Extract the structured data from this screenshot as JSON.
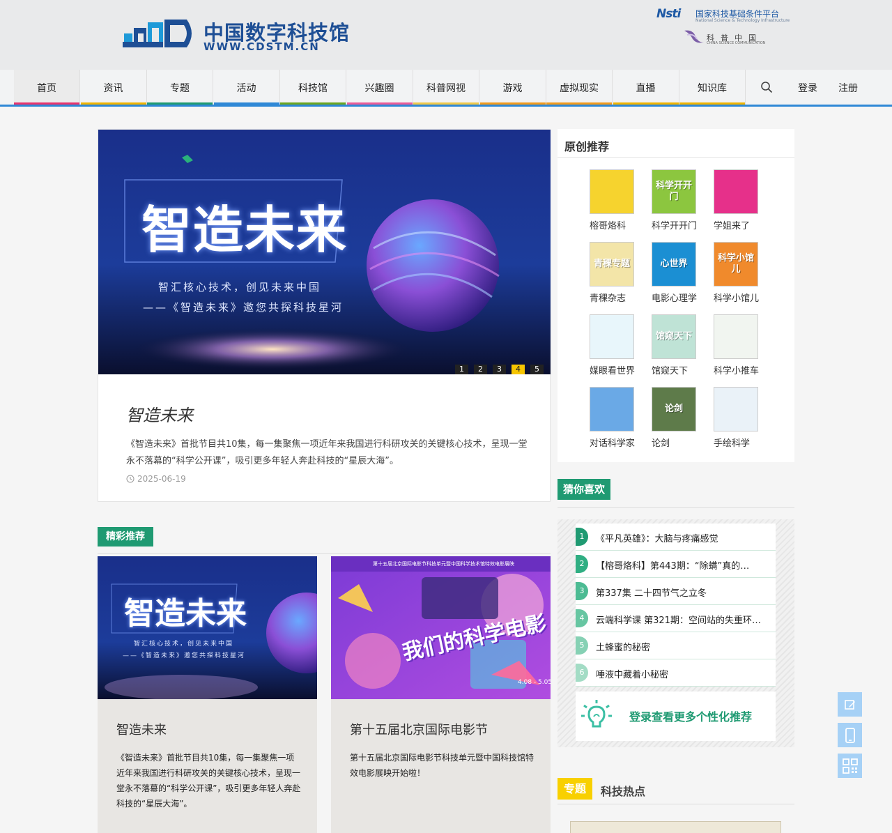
{
  "header": {
    "logo_cn": "中国数字科技馆",
    "logo_en": "WWW.CDSTM.CN",
    "partner1_mark": "Nsti",
    "partner1_cn": "国家科技基础条件平台",
    "partner1_en": "National Science & Technology Infrastructure",
    "partner2_cn": "科普中国",
    "partner2_en": "CHINA SCIENCE COMMUNICATION"
  },
  "nav": {
    "items": [
      {
        "label": "首页",
        "color": "#e8336d"
      },
      {
        "label": "资讯",
        "color": "#f0b400"
      },
      {
        "label": "专题",
        "color": "#1f9a72"
      },
      {
        "label": "活动",
        "color": "#2f88d6"
      },
      {
        "label": "科技馆",
        "color": "#6aa520"
      },
      {
        "label": "兴趣圈",
        "color": "#ea5c98"
      },
      {
        "label": "科普网视",
        "color": "#f0c94a"
      },
      {
        "label": "游戏",
        "color": "#f29b1d"
      },
      {
        "label": "虚拟现实",
        "color": "#f29b1d"
      },
      {
        "label": "直播",
        "color": "#f0b400"
      },
      {
        "label": "知识库",
        "color": "#f0b400"
      }
    ],
    "login": "登录",
    "register": "注册"
  },
  "hero": {
    "banner_title": "智造未来",
    "banner_slogan1": "智汇核心技术，创见未来中国",
    "banner_slogan2": "——《智造未来》邀您共探科技星河",
    "dots": [
      "1",
      "2",
      "3",
      "4",
      "5"
    ],
    "title": "智造未来",
    "desc": "《智造未来》首批节目共10集，每一集聚焦一项近年来我国进行科研攻关的关键核心技术，呈现一堂永不落幕的“科学公开课”，吸引更多年轻人奔赴科技的“星辰大海”。",
    "date": "2025-06-19"
  },
  "featured": {
    "label": "精彩推荐",
    "cards": [
      {
        "title": "智造未来",
        "desc": "《智造未来》首批节目共10集，每一集聚焦一项近年来我国进行科研攻关的关键核心技术，呈现一堂永不落幕的“科学公开课”，吸引更多年轻人奔赴科技的“星辰大海”。",
        "img_title": "智造未来",
        "img_slogan1": "智汇核心技术，创见未来中国",
        "img_slogan2": "——《智造未来》邀您共探科技星河"
      },
      {
        "title": "第十五届北京国际电影节",
        "desc": "第十五届北京国际电影节科技单元暨中国科技馆特效电影展映开始啦！",
        "img_header": "第十五届北京国际电影节科技单元暨中国科学技术馆特效电影展映",
        "img_title": "我们的科学电影",
        "img_dates": "4.08 - 5.05"
      }
    ]
  },
  "originals": {
    "title": "原创推荐",
    "items": [
      {
        "name": "榕哥烙科",
        "thumb_text": "",
        "bg": "#f6d32e"
      },
      {
        "name": "科学开开门",
        "thumb_text": "科学开开门",
        "bg": "#8cc63f"
      },
      {
        "name": "学姐来了",
        "thumb_text": "",
        "bg": "#e6308a"
      },
      {
        "name": "青稞杂志",
        "thumb_text": "青稞专题",
        "bg": "#f3e5a8"
      },
      {
        "name": "电影心理学",
        "thumb_text": "心世界",
        "bg": "#1b8fd3"
      },
      {
        "name": "科学小馆儿",
        "thumb_text": "科学小馆儿",
        "bg": "#f08a2c"
      },
      {
        "name": "媒眼看世界",
        "thumb_text": "",
        "bg": "#e8f6fb"
      },
      {
        "name": "馆窥天下",
        "thumb_text": "馆窥天下",
        "bg": "#bfe3d6"
      },
      {
        "name": "科学小推车",
        "thumb_text": "",
        "bg": "#f1f5f0"
      },
      {
        "name": "对话科学家",
        "thumb_text": "",
        "bg": "#6aa9e6"
      },
      {
        "name": "论剑",
        "thumb_text": "论剑",
        "bg": "#5e7b4a"
      },
      {
        "name": "手绘科学",
        "thumb_text": "",
        "bg": "#eaf2f8"
      }
    ]
  },
  "guess": {
    "label": "猜你喜欢",
    "items": [
      {
        "num": "1",
        "text": "《平凡英雄》：大脑与疼痛感觉"
      },
      {
        "num": "2",
        "text": "【榕哥烙科】第443期：“除螨”真的…"
      },
      {
        "num": "3",
        "text": "第337集 二十四节气之立冬"
      },
      {
        "num": "4",
        "text": "云端科学课 第321期：空间站的失重环…"
      },
      {
        "num": "5",
        "text": "土蜂蜜的秘密"
      },
      {
        "num": "6",
        "text": "唾液中藏着小秘密"
      }
    ],
    "num_colors": [
      "#1f9a72",
      "#2fae82",
      "#4cbb93",
      "#67c6a2",
      "#86d1b4",
      "#a3dcc5"
    ],
    "login_prompt": "登录查看更多个性化推荐"
  },
  "topics": {
    "label": "专题",
    "title": "科技热点"
  }
}
